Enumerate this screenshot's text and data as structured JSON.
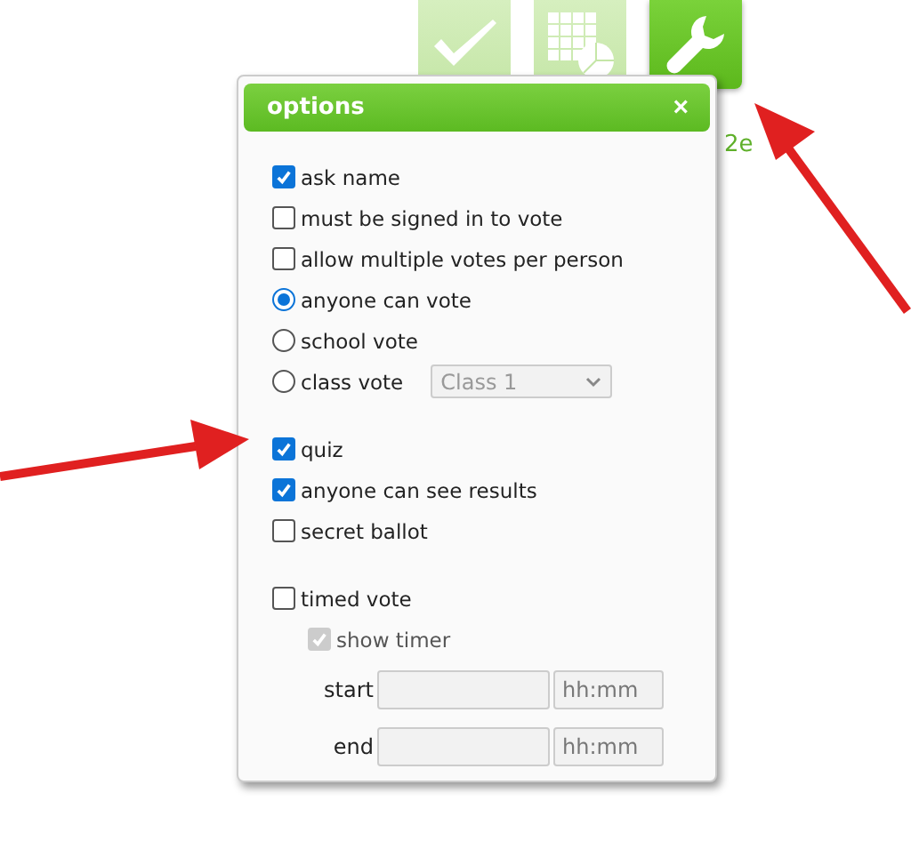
{
  "toolbar": [
    {
      "kind": "check",
      "selected": false
    },
    {
      "kind": "chart",
      "selected": false
    },
    {
      "kind": "wrench",
      "selected": true
    }
  ],
  "partial_label": "2e",
  "dialog": {
    "title": "options",
    "close": "×",
    "groups": [
      [
        {
          "kind": "checkbox",
          "label": "ask name",
          "checked": true
        },
        {
          "kind": "checkbox",
          "label": "must be signed in to vote",
          "checked": false
        },
        {
          "kind": "checkbox",
          "label": "allow multiple votes per person",
          "checked": false
        },
        {
          "kind": "radio",
          "label": "anyone can vote",
          "selected": true
        },
        {
          "kind": "radio",
          "label": "school vote",
          "selected": false
        },
        {
          "kind": "radio",
          "label": "class vote",
          "selected": false,
          "select": {
            "value": "Class 1",
            "disabled": true
          }
        }
      ],
      [
        {
          "kind": "checkbox",
          "label": "quiz",
          "checked": true
        },
        {
          "kind": "checkbox",
          "label": "anyone can see results",
          "checked": true
        },
        {
          "kind": "checkbox",
          "label": "secret ballot",
          "checked": false
        }
      ],
      [
        {
          "kind": "checkbox",
          "label": "timed vote",
          "checked": false,
          "children": [
            {
              "kind": "checkbox",
              "label": "show timer",
              "checked": true,
              "disabled": true
            }
          ]
        }
      ]
    ],
    "times": [
      {
        "label": "start",
        "placeholder": "hh:mm"
      },
      {
        "label": "end",
        "placeholder": "hh:mm"
      }
    ]
  }
}
